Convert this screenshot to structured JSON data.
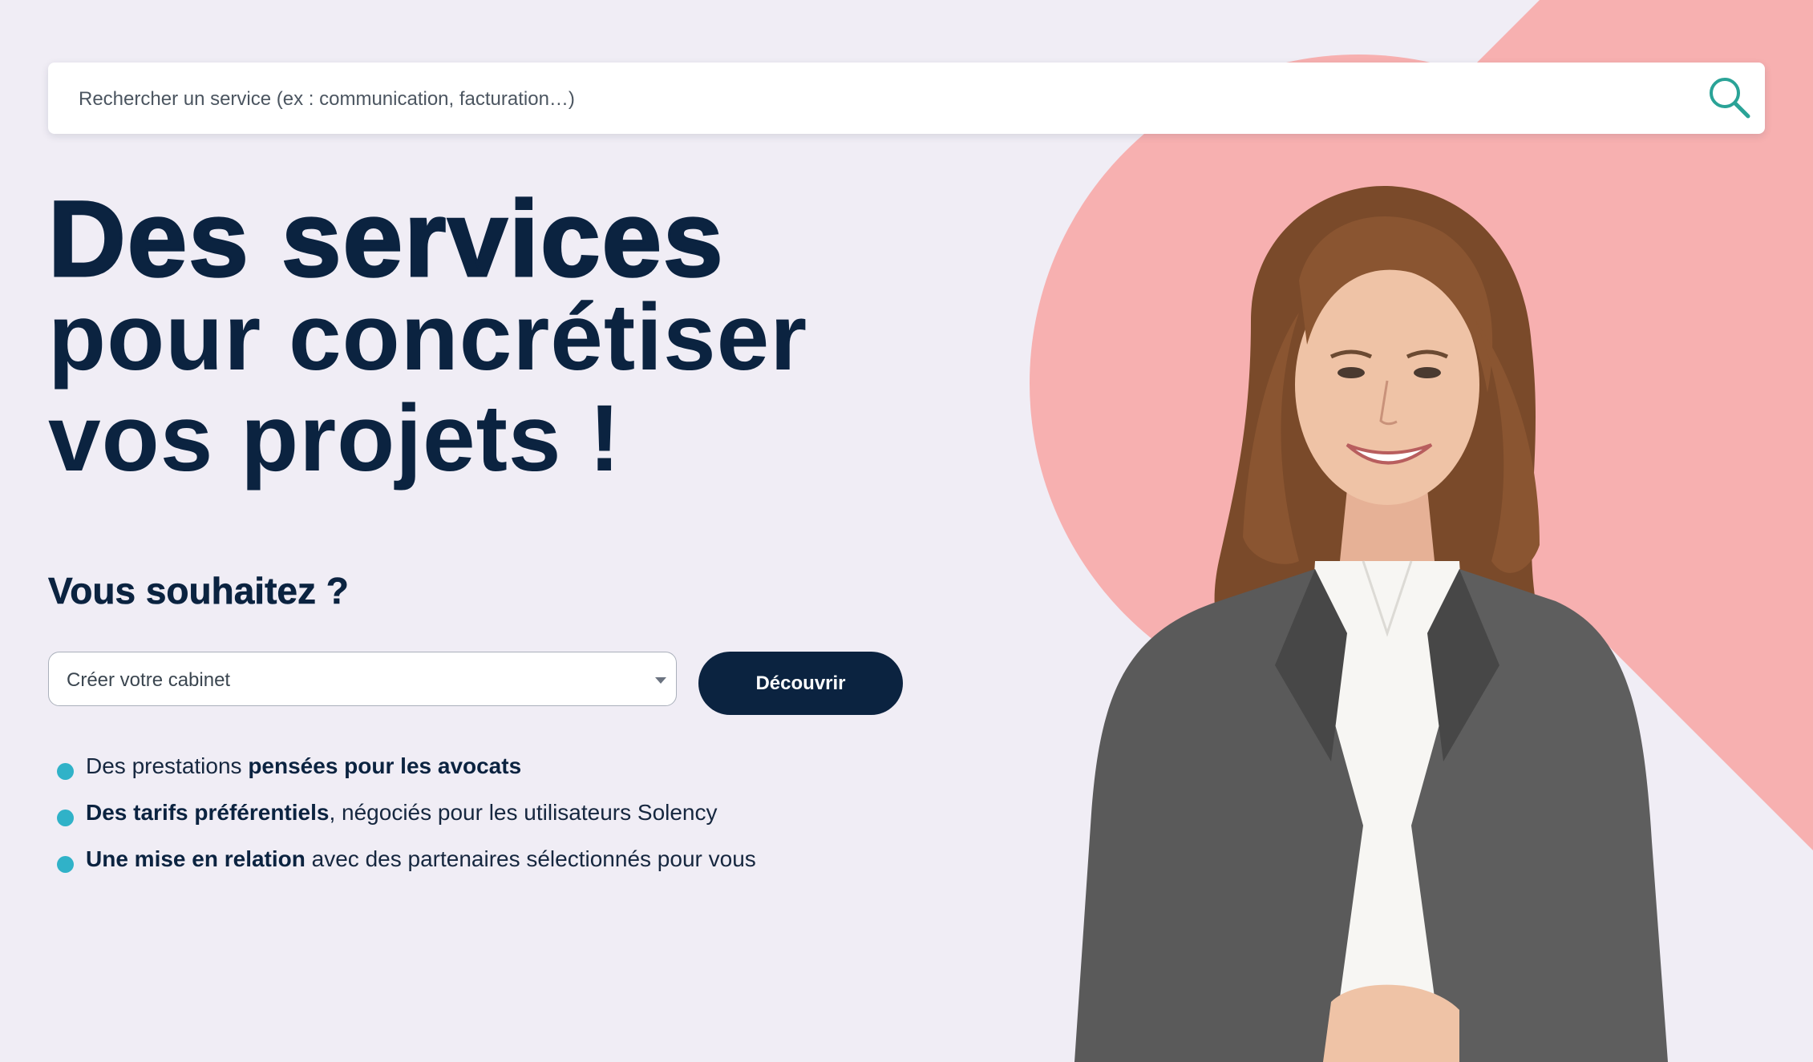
{
  "search": {
    "placeholder": "Rechercher un service (ex : communication, facturation…)",
    "icon": "search-icon",
    "icon_color": "#2aa397"
  },
  "hero": {
    "title_line1": "Des services",
    "title_line2": "pour concrétiser",
    "title_line3": "vos projets !",
    "subtitle": "Vous souhaitez ?"
  },
  "form": {
    "select_value": "Créer votre cabinet",
    "button_label": "Découvrir"
  },
  "features": [
    {
      "before": "Des prestations ",
      "bold": "pensées pour les avocats",
      "after": ""
    },
    {
      "before": "",
      "bold": "Des tarifs préférentiels",
      "after": ", négociés pour les utilisateurs Solency"
    },
    {
      "before": "",
      "bold": "Une mise en relation",
      "after": " avec des partenaires sélectionnés pour vous"
    }
  ],
  "colors": {
    "background": "#f0edf5",
    "primary_navy": "#0b2340",
    "accent_pink": "#f7b0b0",
    "bullet_teal": "#30b2c8"
  }
}
